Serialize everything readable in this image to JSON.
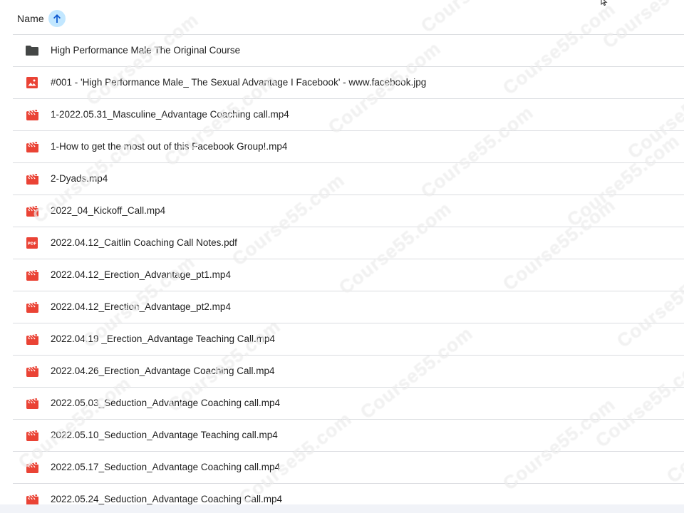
{
  "header": {
    "name_label": "Name",
    "sort_icon": "arrow-upward-icon",
    "sort_color": "#c2e7ff"
  },
  "colors": {
    "video": "#ea4335",
    "image": "#ea4335",
    "pdf": "#ea4335",
    "folder": "#444746",
    "divider": "#dadce0"
  },
  "files": [
    {
      "name": "High Performance Male The Original Course",
      "type": "folder",
      "icon": "folder-icon"
    },
    {
      "name": "#001 - 'High Performance Male_ The Sexual Advantage I Facebook' - www.facebook.jpg",
      "type": "image",
      "icon": "image-icon"
    },
    {
      "name": "1-2022.05.31_Masculine_Advantage Coaching call.mp4",
      "type": "video",
      "icon": "video-icon"
    },
    {
      "name": "1-How to get the most out of this Facebook Group!.mp4",
      "type": "video",
      "icon": "video-icon"
    },
    {
      "name": "2-Dyads.mp4",
      "type": "video",
      "icon": "video-icon"
    },
    {
      "name": "2022_04_Kickoff_Call.mp4",
      "type": "video",
      "icon": "video-icon"
    },
    {
      "name": "2022.04.12_Caitlin Coaching Call Notes.pdf",
      "type": "pdf",
      "icon": "pdf-icon"
    },
    {
      "name": "2022.04.12_Erection_Advantage_pt1.mp4",
      "type": "video",
      "icon": "video-icon"
    },
    {
      "name": "2022.04.12_Erection_Advantage_pt2.mp4",
      "type": "video",
      "icon": "video-icon"
    },
    {
      "name": "2022.04.19 _Erection_Advantage Teaching Call.mp4",
      "type": "video",
      "icon": "video-icon"
    },
    {
      "name": "2022.04.26_Erection_Advantage Coaching Call.mp4",
      "type": "video",
      "icon": "video-icon"
    },
    {
      "name": "2022.05.03_Seduction_Advantage Coaching call.mp4",
      "type": "video",
      "icon": "video-icon"
    },
    {
      "name": "2022.05.10_Seduction_Advantage Teaching call.mp4",
      "type": "video",
      "icon": "video-icon"
    },
    {
      "name": "2022.05.17_Seduction_Advantage Coaching call.mp4",
      "type": "video",
      "icon": "video-icon"
    },
    {
      "name": "2022.05.24_Seduction_Advantage Coaching Call.mp4",
      "type": "video",
      "icon": "video-icon"
    }
  ],
  "watermark": {
    "text": "Course55.com"
  }
}
